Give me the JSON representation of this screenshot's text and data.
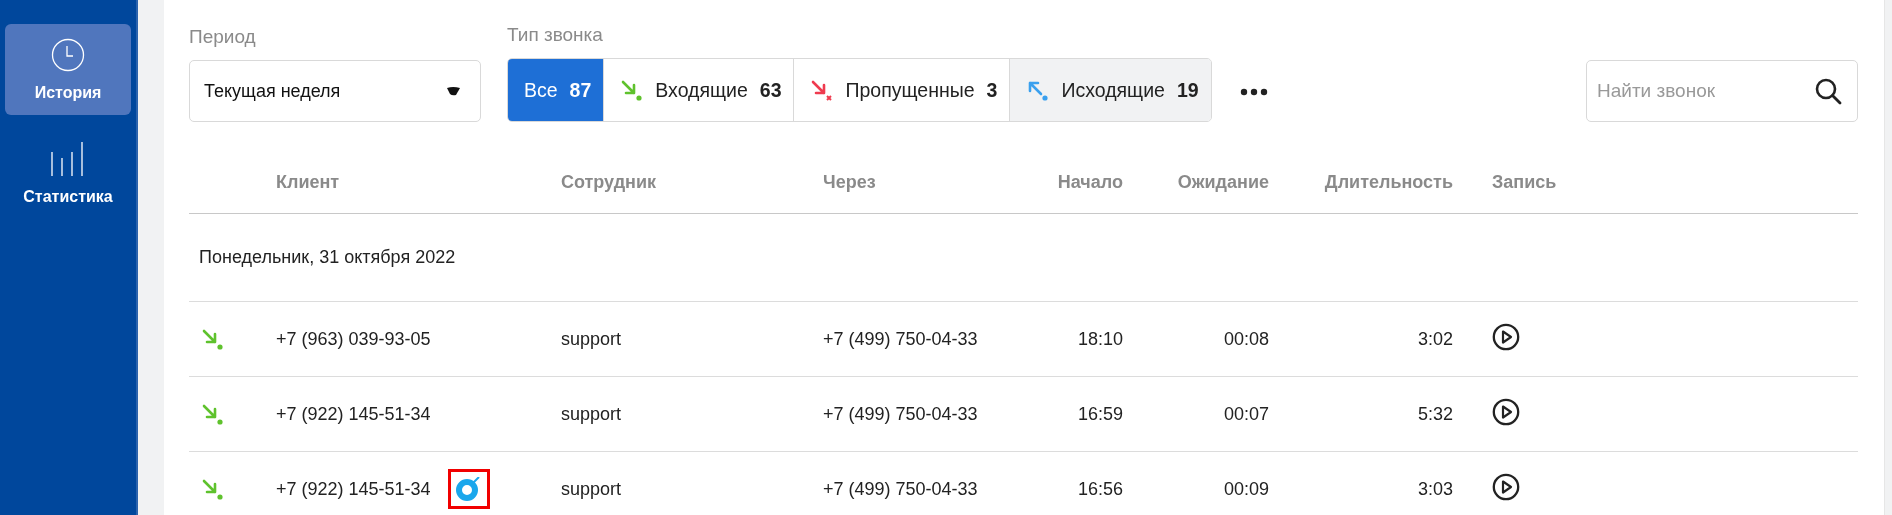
{
  "sidebar": {
    "items": [
      {
        "kind": "clock",
        "label": "История",
        "selected": true
      },
      {
        "kind": "bars",
        "label": "Статистика",
        "selected": false
      }
    ]
  },
  "filters": {
    "period": {
      "label": "Период",
      "value": "Текущая неделя"
    },
    "call_type": {
      "label": "Тип звонка",
      "options": [
        {
          "kind": "all",
          "label": "Все",
          "count": "87",
          "selected": true,
          "highlighted": false
        },
        {
          "kind": "incoming",
          "label": "Входящие",
          "count": "63",
          "selected": false,
          "highlighted": false
        },
        {
          "kind": "missed",
          "label": "Пропущенные",
          "count": "3",
          "selected": false,
          "highlighted": false
        },
        {
          "kind": "outgoing",
          "label": "Исходящие",
          "count": "19",
          "selected": false,
          "highlighted": true
        }
      ]
    },
    "search": {
      "placeholder": "Найти звонок"
    }
  },
  "table": {
    "columns": [
      "Клиент",
      "Сотрудник",
      "Через",
      "Начало",
      "Ожидание",
      "Длительность",
      "Запись"
    ],
    "groups": [
      {
        "date": "Понедельник, 31 октября 2022",
        "rows": [
          {
            "kind": "incoming",
            "client": "+7 (963) 039-93-05",
            "marked": false,
            "employee": "support",
            "via": "+7 (499) 750-04-33",
            "start": "18:10",
            "wait": "00:08",
            "duration": "3:02"
          },
          {
            "kind": "incoming",
            "client": "+7 (922) 145-51-34",
            "marked": false,
            "employee": "support",
            "via": "+7 (499) 750-04-33",
            "start": "16:59",
            "wait": "00:07",
            "duration": "5:32"
          },
          {
            "kind": "incoming",
            "client": "+7 (922) 145-51-34",
            "marked": true,
            "employee": "support",
            "via": "+7 (499) 750-04-33",
            "start": "16:56",
            "wait": "00:09",
            "duration": "3:03"
          }
        ]
      }
    ]
  }
}
